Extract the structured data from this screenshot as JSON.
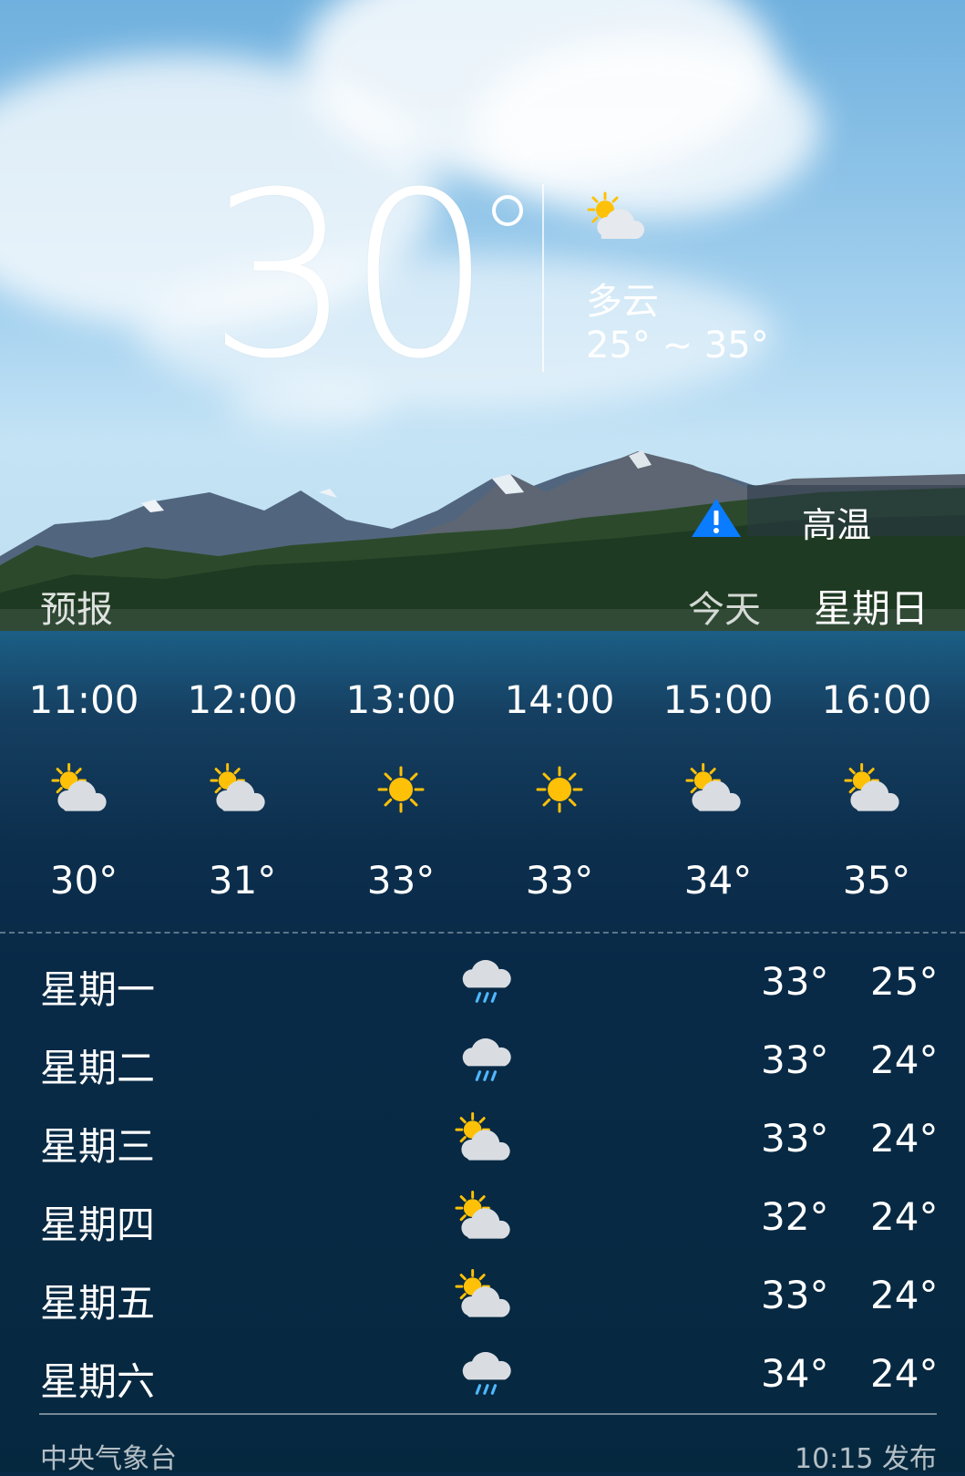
{
  "current": {
    "temperature": "30",
    "condition": "多云",
    "range": "25° ~ 35°",
    "condition_icon": "partly-cloudy-icon"
  },
  "alert": {
    "label": "高温",
    "icon": "warning-triangle-icon",
    "color": "#0a7cff"
  },
  "nav": {
    "forecast": "预报",
    "today": "今天",
    "weekday": "星期日"
  },
  "hourly": [
    {
      "time": "11:00",
      "icon": "partly-cloudy-icon",
      "temp": "30°"
    },
    {
      "time": "12:00",
      "icon": "partly-cloudy-icon",
      "temp": "31°"
    },
    {
      "time": "13:00",
      "icon": "sunny-icon",
      "temp": "33°"
    },
    {
      "time": "14:00",
      "icon": "sunny-icon",
      "temp": "33°"
    },
    {
      "time": "15:00",
      "icon": "partly-cloudy-icon",
      "temp": "34°"
    },
    {
      "time": "16:00",
      "icon": "partly-cloudy-icon",
      "temp": "35°"
    }
  ],
  "daily": [
    {
      "day": "星期一",
      "icon": "rain-icon",
      "high": "33°",
      "low": "25°"
    },
    {
      "day": "星期二",
      "icon": "rain-icon",
      "high": "33°",
      "low": "24°"
    },
    {
      "day": "星期三",
      "icon": "partly-cloudy-icon",
      "high": "33°",
      "low": "24°"
    },
    {
      "day": "星期四",
      "icon": "partly-cloudy-icon",
      "high": "32°",
      "low": "24°"
    },
    {
      "day": "星期五",
      "icon": "partly-cloudy-icon",
      "high": "33°",
      "low": "24°"
    },
    {
      "day": "星期六",
      "icon": "rain-icon",
      "high": "34°",
      "low": "24°"
    }
  ],
  "footer": {
    "source": "中央气象台",
    "published": "10:15 发布"
  },
  "colors": {
    "sun": "#ffc107",
    "cloud": "#d9dde2",
    "rain": "#4fb8ff",
    "panel": "#082a47"
  }
}
